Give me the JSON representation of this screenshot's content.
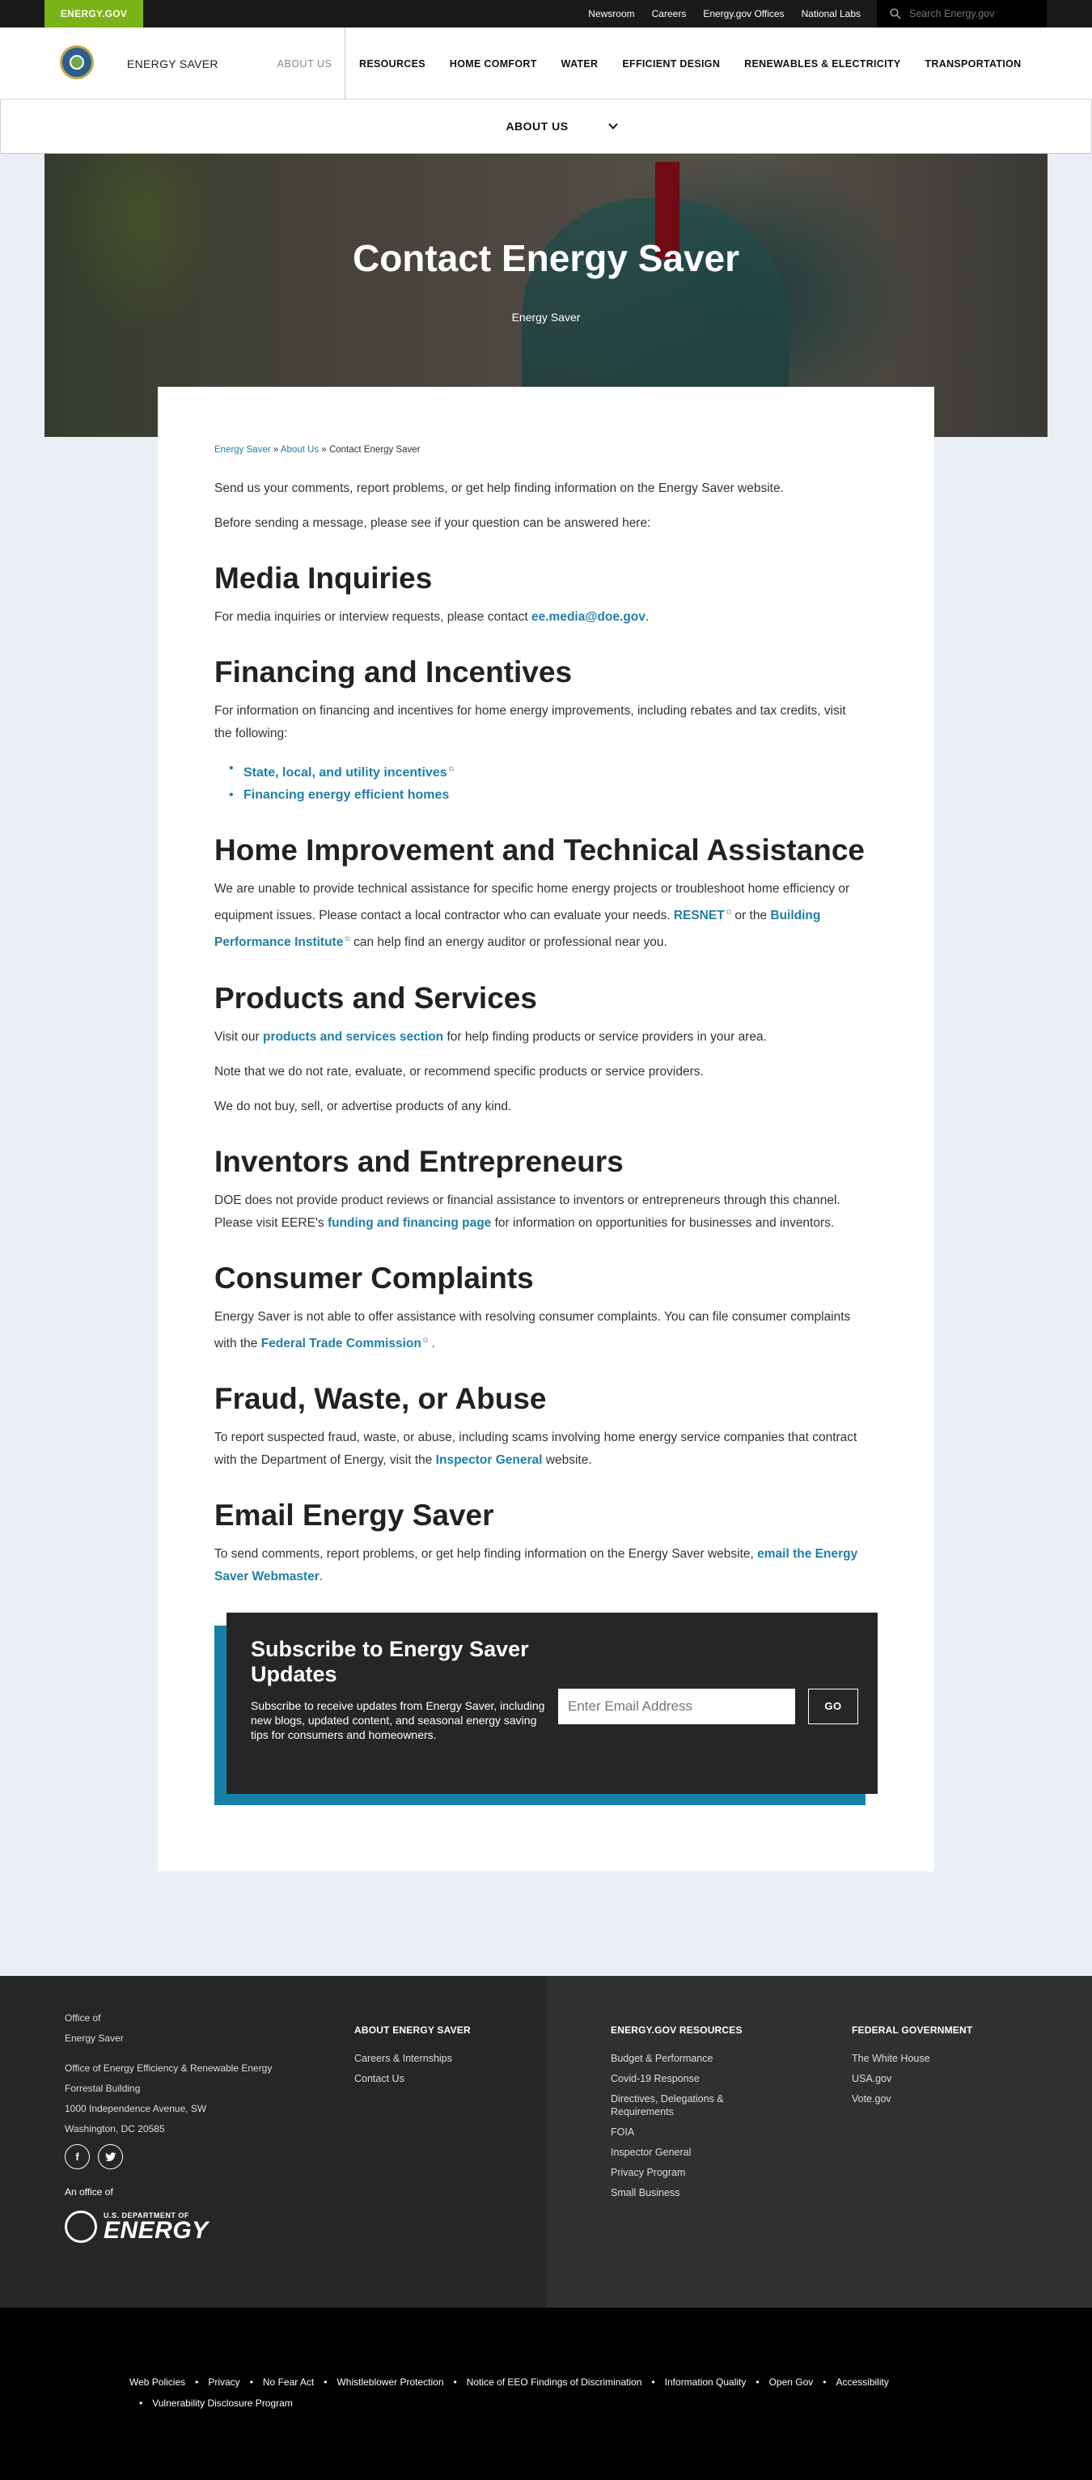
{
  "topbar": {
    "brand": "ENERGY.GOV",
    "links": [
      "Newsroom",
      "Careers",
      "Energy.gov Offices",
      "National Labs"
    ],
    "search_placeholder": "Search Energy.gov"
  },
  "header": {
    "site_name": "ENERGY SAVER",
    "about": "ABOUT US",
    "nav": [
      "RESOURCES",
      "HOME COMFORT",
      "WATER",
      "EFFICIENT DESIGN",
      "RENEWABLES & ELECTRICITY",
      "TRANSPORTATION"
    ]
  },
  "subnav": {
    "label": "ABOUT US"
  },
  "hero": {
    "title": "Contact Energy Saver",
    "subtitle": "Energy Saver"
  },
  "breadcrumb": {
    "home": "Energy Saver",
    "sep": " » ",
    "parent": "About Us",
    "current": "Contact Energy Saver"
  },
  "intro": {
    "p1": "Send us your comments, report problems, or get help finding information on the Energy Saver website.",
    "p2": "Before sending a message, please see if your question can be answered here:"
  },
  "media": {
    "heading": "Media Inquiries",
    "text": "For media inquiries or interview requests, please contact ",
    "email": "ee.media@doe.gov",
    "end": "."
  },
  "financing": {
    "heading": "Financing and Incentives",
    "text": "For information on financing and incentives for home energy improvements, including rebates and tax credits, visit the following:",
    "links": [
      "State, local, and utility incentives",
      "Financing energy efficient homes"
    ]
  },
  "home_improvement": {
    "heading": "Home Improvement and Technical Assistance",
    "text1": "We are unable to provide technical assistance for specific home energy projects or troubleshoot home efficiency or equipment issues. Please contact a local contractor who can evaluate your needs. ",
    "link1": "RESNET",
    "text2": " or the ",
    "link2": "Building Performance Institute",
    "text3": " can help find an energy auditor or professional near you."
  },
  "products": {
    "heading": "Products and Services",
    "p1_a": "Visit our ",
    "p1_link": "products and services section",
    "p1_b": " for help finding products or service providers in your area.",
    "p2": "Note that we do not rate, evaluate, or recommend specific products or service providers.",
    "p3": "We do not buy, sell, or advertise products of any kind."
  },
  "inventors": {
    "heading": "Inventors and Entrepreneurs",
    "text_a": "DOE does not provide product reviews or financial assistance to inventors or entrepreneurs through this channel. Please visit EERE's ",
    "link": "funding and financing page",
    "text_b": " for information on opportunities for businesses and inventors."
  },
  "complaints": {
    "heading": "Consumer Complaints",
    "text_a": "Energy Saver is not able to offer assistance with resolving consumer complaints. You can file consumer complaints with the ",
    "link": "Federal Trade Commission",
    "text_b": " ."
  },
  "fraud": {
    "heading": "Fraud, Waste, or Abuse",
    "text_a": "To report suspected fraud, waste, or abuse, including scams involving home energy service companies that contract with the Department of Energy, visit the ",
    "link": "Inspector General",
    "text_b": " website."
  },
  "email": {
    "heading": "Email Energy Saver",
    "text_a": "To send comments, report problems, or get help finding information on the Energy Saver website, ",
    "link": "email the Energy Saver Webmaster",
    "text_b": "."
  },
  "subscribe": {
    "title": "Subscribe to Energy Saver Updates",
    "desc": "Subscribe to receive updates from Energy Saver, including new blogs, updated content, and seasonal energy saving tips for consumers and homeowners.",
    "placeholder": "Enter Email Address",
    "button": "GO"
  },
  "footer": {
    "office_line1": "Office of",
    "office_line2": "Energy Saver",
    "addr1": "Office of Energy Efficiency & Renewable Energy",
    "addr2": "Forrestal Building",
    "addr3": "1000 Independence Avenue, SW",
    "addr4": "Washington, DC 20585",
    "facebook": "f",
    "twitter": "t",
    "an_office_of": "An office of",
    "doe_small": "U.S. DEPARTMENT OF",
    "doe_big": "ENERGY",
    "col1": {
      "title": "ABOUT ENERGY SAVER",
      "links": [
        "Careers & Internships",
        "Contact Us"
      ]
    },
    "col2": {
      "title": "ENERGY.GOV RESOURCES",
      "links": [
        "Budget & Performance",
        "Covid-19 Response",
        "Directives, Delegations & Requirements",
        "FOIA",
        "Inspector General",
        "Privacy Program",
        "Small Business"
      ]
    },
    "col3": {
      "title": "FEDERAL GOVERNMENT",
      "links": [
        "The White House",
        "USA.gov",
        "Vote.gov"
      ]
    }
  },
  "bottom_links": [
    "Web Policies",
    "Privacy",
    "No Fear Act",
    "Whistleblower Protection",
    "Notice of EEO Findings of Discrimination",
    "Information Quality",
    "Open Gov",
    "Accessibility",
    "Vulnerability Disclosure Program"
  ],
  "colors": {
    "brand_green": "#7ab317",
    "link": "#1f7fa6",
    "dark": "#262626"
  }
}
